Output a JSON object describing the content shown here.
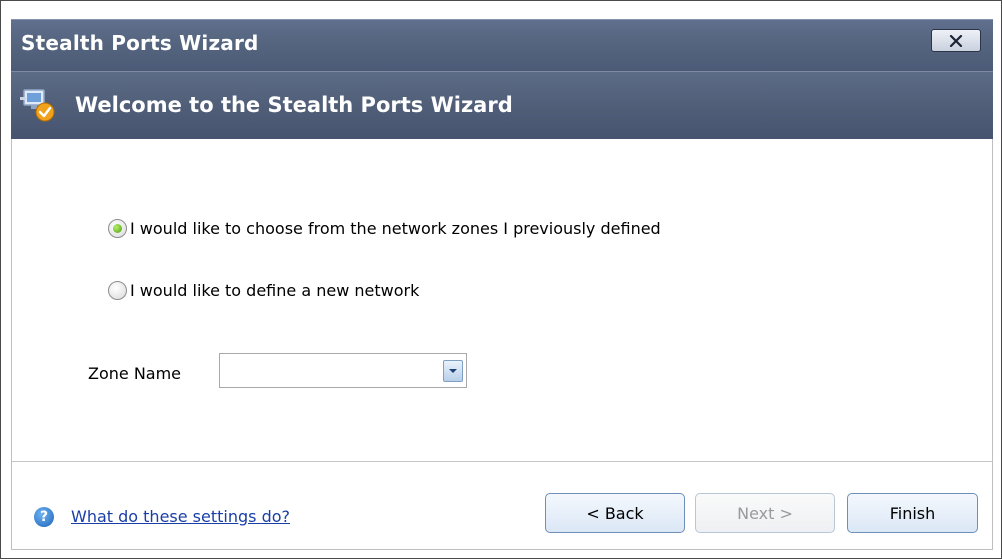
{
  "window": {
    "title": "Stealth Ports Wizard",
    "close_icon": "close-icon"
  },
  "banner": {
    "heading": "Welcome to the Stealth Ports Wizard",
    "icon": "wizard-network-icon"
  },
  "options": [
    {
      "label": "I would like to choose from the network zones I previously defined",
      "selected": true
    },
    {
      "label": "I would like to define a new network",
      "selected": false
    }
  ],
  "zone": {
    "label": "Zone Name",
    "value": ""
  },
  "footer": {
    "help_link": "What do these settings do?",
    "back_label": "< Back",
    "next_label": "Next >",
    "finish_label": "Finish"
  },
  "colors": {
    "title_bar": "#55657f",
    "link": "#1a3ea8",
    "radio_selected": "#4f9d12"
  }
}
